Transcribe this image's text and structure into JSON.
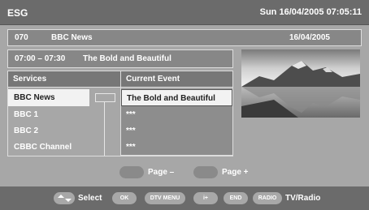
{
  "header": {
    "title": "ESG",
    "datetime": "Sun  16/04/2005  07:05:11"
  },
  "channel": {
    "number": "070",
    "name": "BBC News",
    "date": "16/04/2005"
  },
  "programme": {
    "time": "07:00 – 07:30",
    "name": "The Bold and Beautiful"
  },
  "table": {
    "services_header": "Services",
    "event_header": "Current Event",
    "services": [
      "BBC News",
      "BBC 1",
      "BBC 2",
      "CBBC Channel"
    ],
    "events": [
      "The Bold and Beautiful",
      "***",
      "***",
      "***"
    ]
  },
  "pager": {
    "prev_label": "Page –",
    "next_label": "Page +"
  },
  "footer": {
    "select_label": "Select",
    "ok_key": "OK",
    "dtv_menu_key": "DTV MENU",
    "info_key": "i+",
    "end_key": "END",
    "radio_key": "RADIO",
    "tv_radio_label": "TV/Radio"
  },
  "preview": {
    "icon": "mountain-lake-image"
  }
}
